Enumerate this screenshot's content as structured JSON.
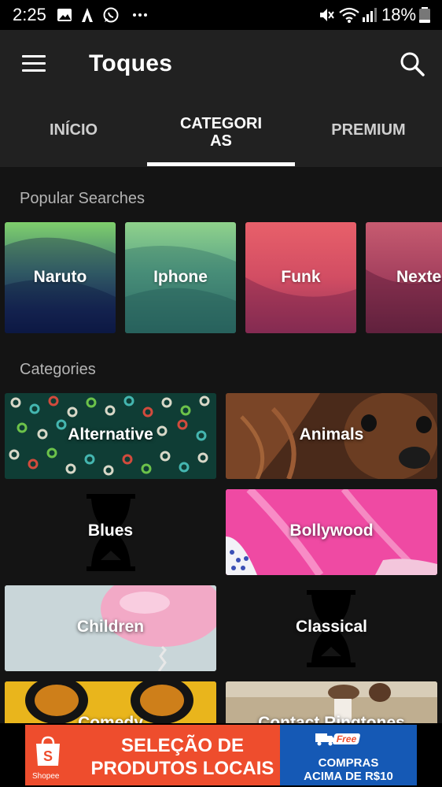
{
  "status_bar": {
    "time": "2:25",
    "battery": "18%",
    "icons": [
      "image-icon",
      "a-logo-icon",
      "whatsapp-icon",
      "more-icon",
      "mute-icon",
      "wifi-icon",
      "signal-icon",
      "battery-icon"
    ]
  },
  "app_bar": {
    "title": "Toques",
    "menu_icon": "menu-icon",
    "search_icon": "search-icon"
  },
  "tabs": [
    {
      "label": "INÍCIO",
      "selected": false
    },
    {
      "label": "CATEGORIAS",
      "selected": true
    },
    {
      "label": "PREMIUM",
      "selected": false
    }
  ],
  "popular": {
    "title": "Popular Searches",
    "items": [
      {
        "label": "Naruto",
        "colors": [
          "#8fcf6f",
          "#223a6b",
          "#0c1d4a"
        ]
      },
      {
        "label": "Iphone",
        "colors": [
          "#88c98a",
          "#3f8f7f",
          "#2e6a64"
        ]
      },
      {
        "label": "Funk",
        "colors": [
          "#e65c67",
          "#c9475f",
          "#8e3251"
        ]
      },
      {
        "label": "Nexte",
        "colors": [
          "#c2526b",
          "#9b3e5a",
          "#6f2b44"
        ]
      }
    ]
  },
  "categories": {
    "title": "Categories",
    "items": [
      {
        "label": "Alternative"
      },
      {
        "label": "Animals"
      },
      {
        "label": "Blues"
      },
      {
        "label": "Bollywood"
      },
      {
        "label": "Children"
      },
      {
        "label": "Classical"
      },
      {
        "label": "Comedy"
      },
      {
        "label": "Contact Ringtones"
      }
    ]
  },
  "ad": {
    "headline_line1": "SELEÇÃO DE",
    "headline_line2": "PRODUTOS LOCAIS",
    "brand": "Shopee",
    "badge": "Free",
    "offer_line1": "COMPRAS",
    "offer_line2": "ACIMA DE R$10",
    "colors": {
      "left": "#ee4d2d",
      "right": "#1559b5"
    }
  },
  "colors": {
    "app_bar": "#212121",
    "background": "#141414",
    "status_bar": "#000000"
  }
}
